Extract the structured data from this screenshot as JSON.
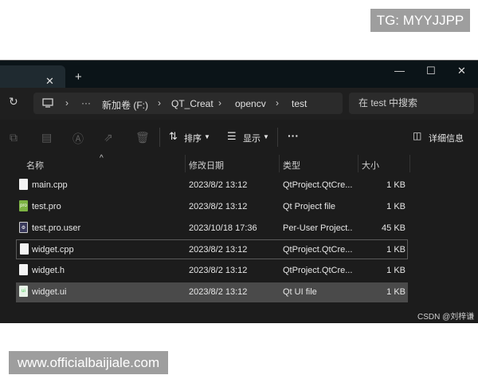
{
  "watermarks": {
    "tg": "TG: MYYJJPP",
    "www": "www.officialbaijiale.com"
  },
  "window": {
    "tab_close": "✕",
    "new_tab": "+",
    "controls": {
      "minimize": "—",
      "maximize": "☐",
      "close": "✕"
    }
  },
  "address": {
    "refresh": "↻",
    "more": "···",
    "crumbs": [
      "新加卷 (F:)",
      "QT_Creat",
      "opencv",
      "test"
    ],
    "search_placeholder": "在 test 中搜索"
  },
  "toolbar": {
    "sort_label": "排序",
    "view_label": "显示",
    "more_label": "···",
    "details_label": "详细信息"
  },
  "columns": {
    "name": "名称",
    "modified": "修改日期",
    "type": "类型",
    "size": "大小"
  },
  "files": [
    {
      "name": "main.cpp",
      "modified": "2023/8/2 13:12",
      "type": "QtProject.QtCre...",
      "size": "1 KB",
      "icon": "cpp-file-icon"
    },
    {
      "name": "test.pro",
      "modified": "2023/8/2 13:12",
      "type": "Qt Project file",
      "size": "1 KB",
      "icon": "pro-file-icon"
    },
    {
      "name": "test.pro.user",
      "modified": "2023/10/18 17:36",
      "type": "Per-User Project...",
      "size": "45 KB",
      "icon": "user-file-icon"
    },
    {
      "name": "widget.cpp",
      "modified": "2023/8/2 13:12",
      "type": "QtProject.QtCre...",
      "size": "1 KB",
      "icon": "cpp-file-icon"
    },
    {
      "name": "widget.h",
      "modified": "2023/8/2 13:12",
      "type": "QtProject.QtCre...",
      "size": "1 KB",
      "icon": "header-file-icon"
    },
    {
      "name": "widget.ui",
      "modified": "2023/8/2 13:12",
      "type": "Qt UI file",
      "size": "1 KB",
      "icon": "ui-file-icon"
    }
  ],
  "csdn": "CSDN @刘梓谦"
}
